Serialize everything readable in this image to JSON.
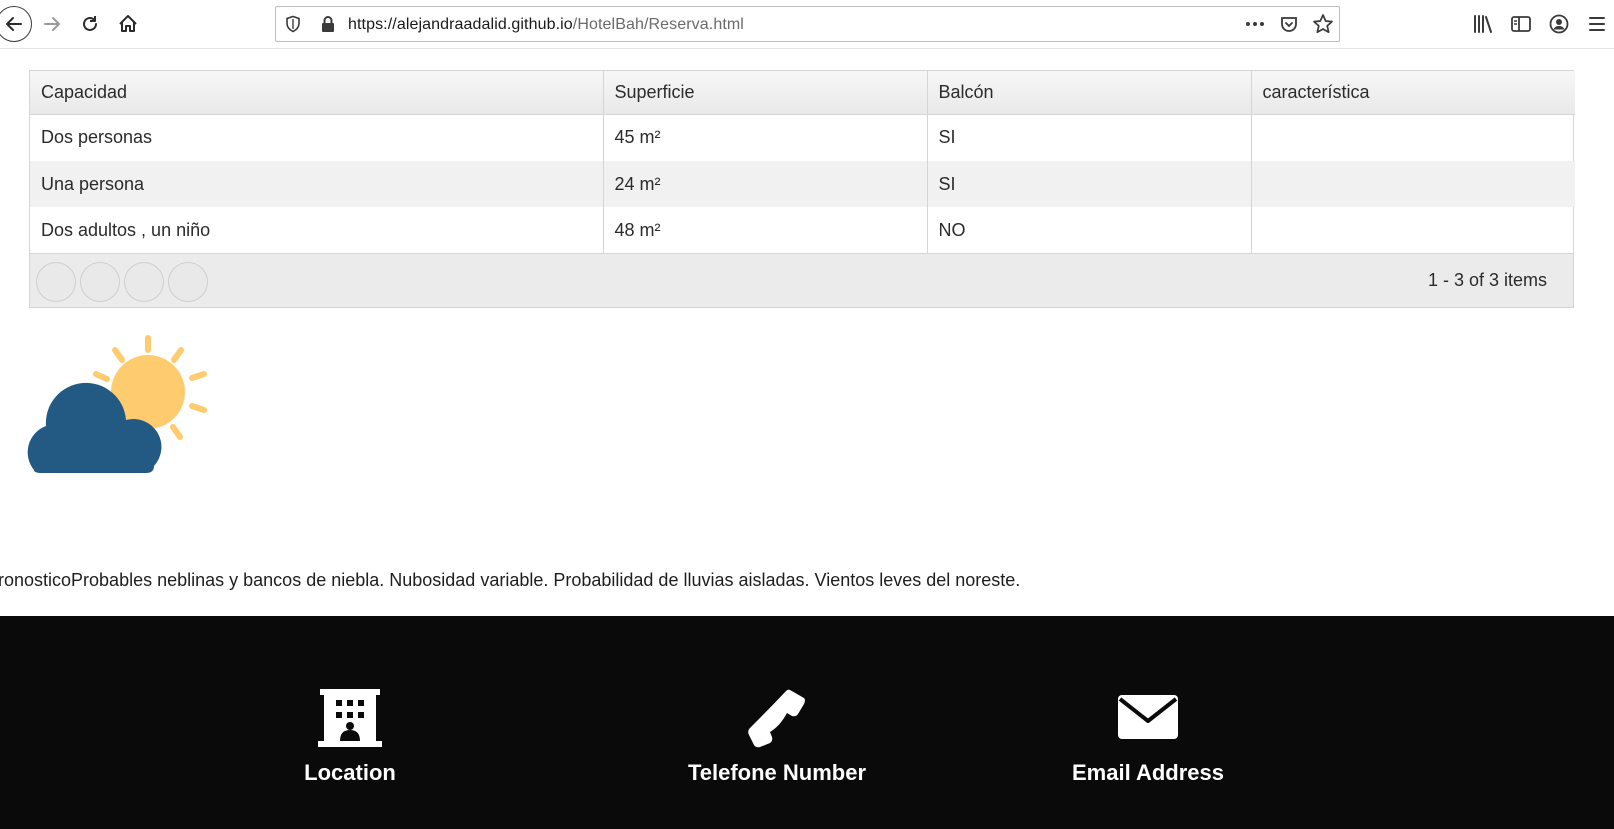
{
  "browser": {
    "url_host": "https://alejandraadalid.github.io",
    "url_path": "/HotelBah/Reserva.html"
  },
  "rooms_table": {
    "headers": [
      "Capacidad",
      "Superficie",
      "Balcón",
      "característica"
    ],
    "rows": [
      [
        "Dos personas",
        "45 m²",
        "SI",
        ""
      ],
      [
        "Una persona",
        "24 m²",
        "SI",
        ""
      ],
      [
        "Dos adultos , un niño",
        "48 m²",
        "NO",
        ""
      ]
    ],
    "pager_info": "1 - 3 of 3 items"
  },
  "weather": {
    "icon": "partly-cloudy-icon",
    "forecast_text": "ronosticoProbables neblinas y bancos de niebla. Nubosidad variable. Probabilidad de lluvias aisladas. Vientos leves del noreste.",
    "colors": {
      "sun": "#fecb6e",
      "cloud": "#235a84"
    }
  },
  "footer": {
    "items": [
      {
        "label": "Location",
        "icon": "building-icon"
      },
      {
        "label": "Telefone Number",
        "icon": "phone-icon"
      },
      {
        "label": "Email Address",
        "icon": "envelope-icon"
      }
    ]
  }
}
